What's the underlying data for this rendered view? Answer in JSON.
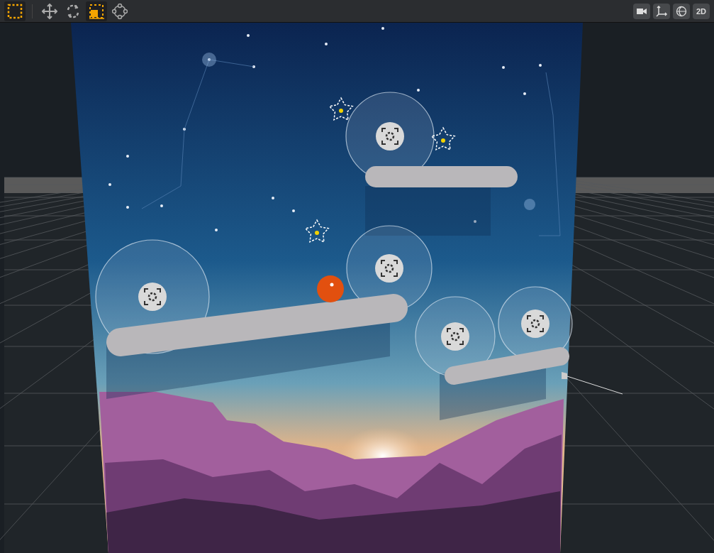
{
  "tools": [
    {
      "kind": "rect",
      "selected": true
    },
    {
      "kind": "move",
      "selected": false
    },
    {
      "kind": "rotate",
      "selected": false
    },
    {
      "kind": "scale",
      "selected": true
    },
    {
      "kind": "transform",
      "selected": false
    }
  ],
  "view_buttons": [
    {
      "kind": "camera"
    },
    {
      "kind": "axes"
    },
    {
      "kind": "globe"
    },
    {
      "kind": "text",
      "label": "2D"
    }
  ]
}
